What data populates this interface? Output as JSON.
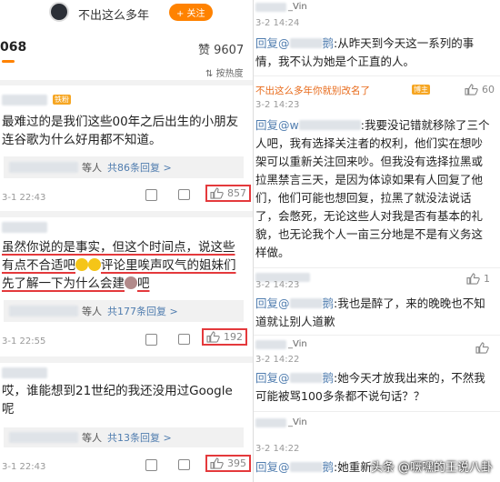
{
  "header": {
    "username": "不出这么多年",
    "follow_label": "+ 关注",
    "post_id_tail": "068",
    "likes": "赞 9607",
    "sort": "按热度"
  },
  "left_comments": [
    {
      "fan_badge": "铁粉",
      "text": "最难过的是我们这些00年之后出生的小朋友连谷歌为什么好用都不知道。",
      "replies_prefix": "等人",
      "replies_link": "共86条回复 >",
      "time": "3-1 22:43",
      "likes": "857"
    },
    {
      "text_a": "虽然你说的是事实，但这个时间点，说这些有点不合适吧",
      "text_b": "评论里唉声叹气的姐妹们先了解一下为什么会建",
      "text_c": "吧",
      "replies_prefix": "等人",
      "replies_link": "共177条回复 >",
      "time": "3-1 22:55",
      "likes": "192"
    },
    {
      "text": "哎，谁能想到21世纪的我还没用过Google呢",
      "replies_prefix": "等人",
      "replies_link": "共13条回复 >",
      "time": "3-1 22:43",
      "likes": "395"
    }
  ],
  "right_replies": [
    {
      "name_suffix": "_Vin",
      "time": "3-2 14:24",
      "reply_prefix": "回复@",
      "reply_name_tail": "鹅",
      "text": ":从昨天到今天这一系列的事情，我不认为她是个正直的人。"
    },
    {
      "name": "不出这么多年你就别改名了",
      "fan_badge": "博主",
      "time": "3-2 14:23",
      "likes": "60",
      "reply_prefix": "回复@w",
      "text": ":我要没记错就移除了三个人吧，我有选择关注者的权利，他们实在想吵架可以重新关注回来吵。但我没有选择拉黑或拉黑禁言三天，是因为体谅如果有人回复了他们，他们可能也想回复，拉黑了就没法说话了，会憋死，无论这些人对我是否有基本的礼貌，也无论我个人一亩三分地是不是有义务这样做。"
    },
    {
      "time": "3-2 14:23",
      "likes": "1",
      "reply_prefix": "回复@",
      "reply_name_tail": "鹅",
      "text": ":我也是醉了，来的晚晚也不知道就让别人道歉"
    },
    {
      "name_suffix": "_Vin",
      "time": "3-2 14:22",
      "reply_prefix": "回复@",
      "reply_name_tail": "鹅",
      "text": ":她今天才放我出来的，不然我可能被骂100多条都不说句话？？"
    },
    {
      "name_suffix": "_Vin",
      "time": "3-2 14:22",
      "reply_prefix": "回复@",
      "reply_name_tail": "鹅",
      "text": ":她重新"
    }
  ],
  "watermark": "头条 @噘嘿的王说八卦"
}
